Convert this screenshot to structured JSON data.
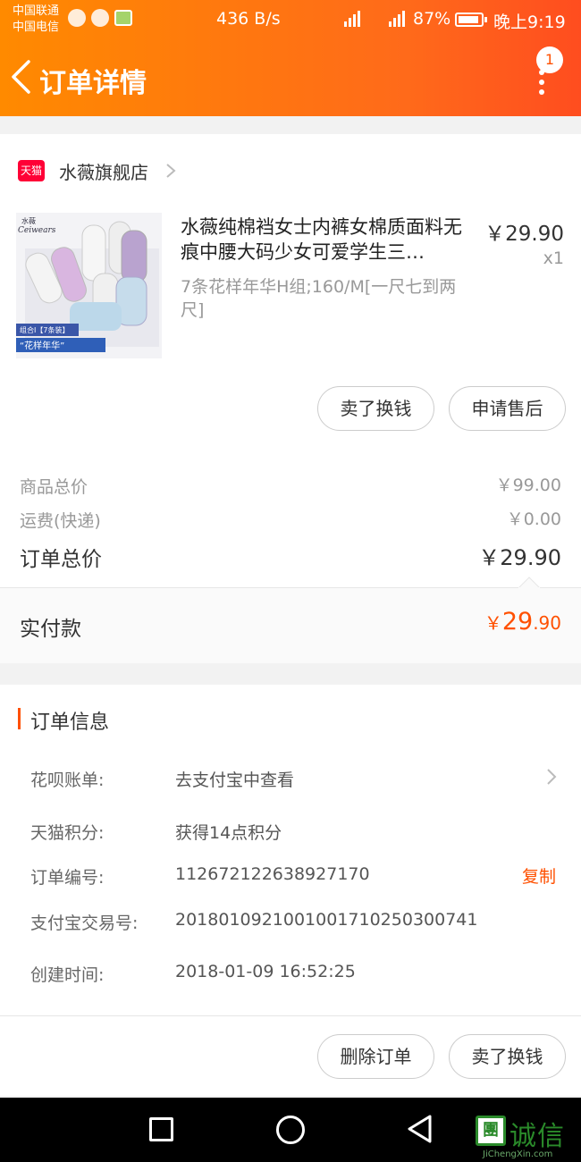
{
  "status_bar": {
    "carrier_1": "中国联通",
    "carrier_2": "中国电信",
    "net_speed": "436 B/s",
    "battery": "87%",
    "time": "晚上9:19"
  },
  "header": {
    "title": "订单详情",
    "badge_count": "1"
  },
  "shop": {
    "logo_text": "天猫",
    "name": "水薇旗舰店"
  },
  "product": {
    "title": "水薇纯棉裆女士内裤女棉质面料无痕中腰大码少女可爱学生三…",
    "sku": "7条花样年华H组;160/M[一尺七到两尺]",
    "price": "￥29.90",
    "qty": "x1",
    "image_brand": "水薇",
    "image_brand_en": "Ceiwears",
    "image_banner": "“花样年华”",
    "image_tag": "组合I【7条装】"
  },
  "item_actions": {
    "sell_label": "卖了换钱",
    "aftersale_label": "申请售后"
  },
  "summary": {
    "goods_label": "商品总价",
    "goods_value": "￥99.00",
    "shipping_label": "运费(快递)",
    "shipping_value": "￥0.00",
    "total_label": "订单总价",
    "total_value": "￥29.90",
    "paid_label": "实付款",
    "paid_yen": "￥",
    "paid_int": "29",
    "paid_dec": ".90",
    "accent_color": "#ff5000"
  },
  "order_info": {
    "section_title": "订单信息",
    "huabei_label": "花呗账单:",
    "huabei_value": "去支付宝中查看",
    "points_label": "天猫积分:",
    "points_value": "获得14点积分",
    "order_no_label": "订单编号:",
    "order_no_value": "112672122638927170",
    "copy_label": "复制",
    "alipay_label": "支付宝交易号:",
    "alipay_value": "2018010921001001710250300741",
    "created_label": "创建时间:",
    "created_value": "2018-01-09 16:52:25"
  },
  "footer_actions": {
    "delete_label": "删除订单",
    "sell_label": "卖了换钱"
  },
  "watermark": {
    "logo": "團",
    "text": "诚信",
    "url": "JiChengXin.com"
  }
}
